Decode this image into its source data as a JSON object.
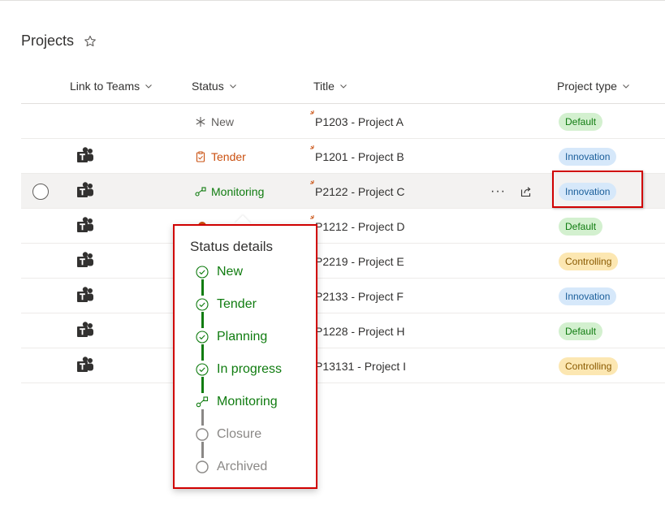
{
  "list": {
    "title": "Projects"
  },
  "columns": {
    "teams": "Link to Teams",
    "status": "Status",
    "title": "Title",
    "type": "Project type"
  },
  "rows": [
    {
      "status": "New",
      "title": "P1203 - Project A",
      "type": "Default"
    },
    {
      "status": "Tender",
      "title": "P1201 - Project B",
      "type": "Innovation"
    },
    {
      "status": "Monitoring",
      "title": "P2122 - Project C",
      "type": "Innovation"
    },
    {
      "status": "",
      "title": "P1212 - Project D",
      "type": "Default"
    },
    {
      "status": "",
      "title": "P2219 - Project E",
      "type": "Controlling"
    },
    {
      "status": "",
      "title": "P2133 - Project F",
      "type": "Innovation"
    },
    {
      "status": "",
      "title": "P1228 - Project H",
      "type": "Default"
    },
    {
      "status": "",
      "title": "P13131 - Project I",
      "type": "Controlling"
    }
  ],
  "row_actions": {
    "more": "···"
  },
  "popup": {
    "heading": "Status details",
    "steps": [
      {
        "label": "New",
        "state": "done"
      },
      {
        "label": "Tender",
        "state": "done"
      },
      {
        "label": "Planning",
        "state": "done"
      },
      {
        "label": "In progress",
        "state": "done"
      },
      {
        "label": "Monitoring",
        "state": "current"
      },
      {
        "label": "Closure",
        "state": "todo"
      },
      {
        "label": "Archived",
        "state": "todo"
      }
    ]
  },
  "colors": {
    "accent_green": "#107c10",
    "tender_orange": "#ca5010",
    "highlight_red": "#d00000",
    "default_pill": "#d3f0cf",
    "innovation_pill": "#d6e8fa",
    "controlling_pill": "#fce7b2"
  },
  "icons": {
    "favorite": "star-icon",
    "teams": "teams-icon",
    "new": "asterisk-icon",
    "tender": "clipboard-icon",
    "monitoring": "flow-icon",
    "share": "share-icon",
    "step_done": "check-circle-icon",
    "step_todo": "empty-circle-icon"
  }
}
